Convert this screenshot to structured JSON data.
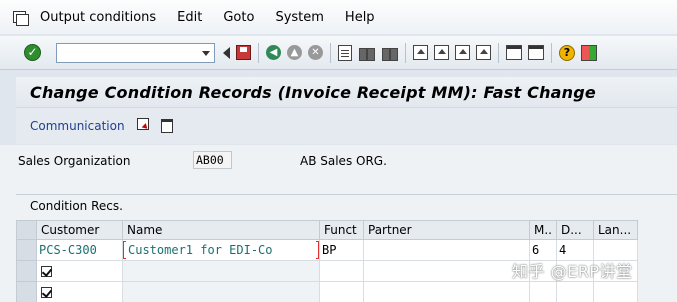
{
  "menu": [
    "Output conditions",
    "Edit",
    "Goto",
    "System",
    "Help"
  ],
  "toolbar": {
    "command_field_value": "",
    "icons": [
      "enter-icon",
      "command-field",
      "back-arrow-icon",
      "save-icon",
      "back-icon",
      "exit-icon",
      "cancel-icon",
      "print-icon",
      "find-icon",
      "find-next-icon",
      "first-page-icon",
      "previous-page-icon",
      "next-page-icon",
      "last-page-icon",
      "create-session-icon",
      "shortcut-icon",
      "help-icon",
      "layout-icon"
    ]
  },
  "title": "Change Condition Records (Invoice Receipt MM): Fast Change",
  "app_toolbar": {
    "communication": "Communication"
  },
  "header": {
    "sales_org_label": "Sales Organization",
    "sales_org_value": "AB00",
    "sales_org_desc": "AB Sales ORG."
  },
  "conditions": {
    "title": "Condition Recs.",
    "columns": [
      "Customer",
      "Name",
      "Funct",
      "Partner",
      "M..",
      "D...",
      "Lan..."
    ],
    "rows": [
      {
        "customer": "PCS-C300",
        "name": "Customer1 for EDI-Co",
        "funct": "BP",
        "partner": "",
        "m": "6",
        "d": "4",
        "lan": ""
      },
      {
        "customer": "",
        "name": "",
        "funct": "",
        "partner": "",
        "m": "",
        "d": "",
        "lan": ""
      },
      {
        "customer": "",
        "name": "",
        "funct": "",
        "partner": "",
        "m": "",
        "d": "",
        "lan": ""
      }
    ]
  },
  "watermark": "知乎 @ERP讲堂"
}
